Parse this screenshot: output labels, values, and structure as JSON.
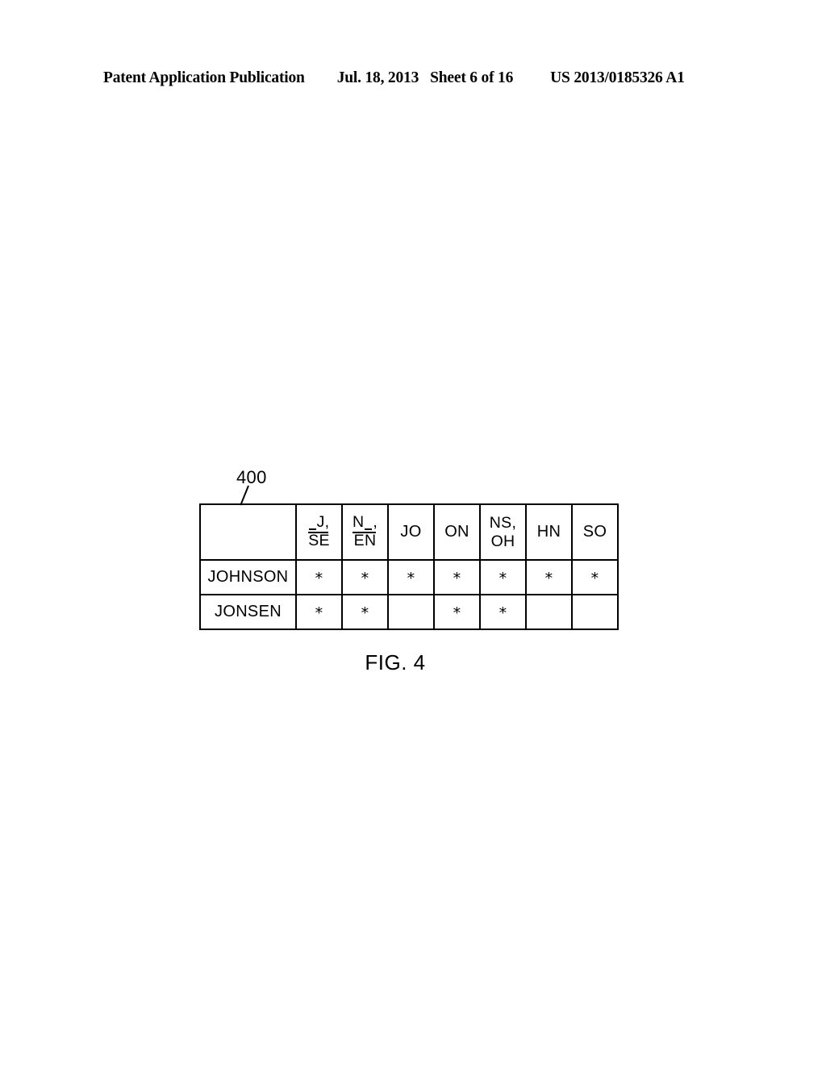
{
  "page_header": {
    "publication": "Patent Application Publication",
    "date": "Jul. 18, 2013",
    "sheet": "Sheet 6 of 16",
    "publication_number": "US 2013/0185326 A1"
  },
  "figure": {
    "reference_numeral": "400",
    "caption": "FIG. 4",
    "table": {
      "corner_label": "",
      "columns": [
        {
          "id": "j-se",
          "type": "fraction",
          "numerator": "J,",
          "numerator_prefix_dash": true,
          "denominator": "SE",
          "denominator_overline": true,
          "plain": "_J, / SE"
        },
        {
          "id": "n-en",
          "type": "fraction",
          "numerator": "N",
          "numerator_suffix": ",",
          "numerator_mid_dash": true,
          "denominator": "EN",
          "denominator_overline": true,
          "plain": "N_, / EN"
        },
        {
          "id": "jo",
          "type": "plain",
          "label": "JO"
        },
        {
          "id": "on",
          "type": "plain",
          "label": "ON"
        },
        {
          "id": "ns-oh",
          "type": "two_line",
          "line1": "NS,",
          "line2": "OH"
        },
        {
          "id": "hn",
          "type": "plain",
          "label": "HN"
        },
        {
          "id": "so",
          "type": "plain",
          "label": "SO"
        }
      ],
      "mark_symbol": "*",
      "rows": [
        {
          "label": "JOHNSON",
          "cells": [
            "*",
            "*",
            "*",
            "*",
            "*",
            "*",
            "*"
          ]
        },
        {
          "label": "JONSEN",
          "cells": [
            "*",
            "*",
            "",
            "*",
            "*",
            "",
            ""
          ]
        }
      ]
    }
  },
  "colors": {
    "background": "#ffffff",
    "ink": "#000000"
  }
}
